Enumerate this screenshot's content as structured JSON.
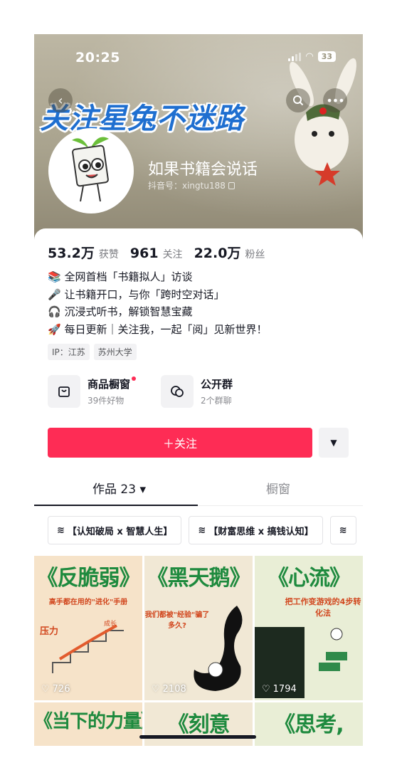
{
  "status_bar": {
    "time": "20:25",
    "battery": "33"
  },
  "banner": {
    "slogan": "关注星兔不迷路"
  },
  "profile": {
    "nickname": "如果书籍会说话",
    "douyin_id": "抖音号：xingtu188"
  },
  "stats": [
    {
      "value": "53.2万",
      "label": "获赞"
    },
    {
      "value": "961",
      "label": "关注"
    },
    {
      "value": "22.0万",
      "label": "粉丝"
    }
  ],
  "bio": [
    {
      "icon": "📚",
      "text": "全网首档「书籍拟人」访谈"
    },
    {
      "icon": "🎤",
      "text": "让书籍开口，与你「跨时空对话」"
    },
    {
      "icon": "🎧",
      "text": "沉浸式听书，解锁智慧宝藏"
    },
    {
      "icon": "🚀",
      "text": "每日更新｜关注我，一起「阅」见新世界！"
    }
  ],
  "tags": [
    "IP：江苏",
    "苏州大学"
  ],
  "features": {
    "shop": {
      "title": "商品橱窗",
      "sub": "39件好物"
    },
    "group": {
      "title": "公开群",
      "sub": "2个群聊"
    }
  },
  "follow_label": "＋关注",
  "tabs": {
    "works": "作品 23 ▾",
    "window": "橱窗"
  },
  "collections": [
    "【认知破局 x 智慧人生】",
    "【财富思维 x 搞钱认知】"
  ],
  "videos": [
    {
      "title": "《反脆弱》",
      "subtitle": "高手都在用的\"进化\"手册",
      "likes": "726"
    },
    {
      "title": "《黑天鹅》",
      "subtitle": "我们都被\"经验\"骗了多久?",
      "likes": "2108"
    },
    {
      "title": "《心流》",
      "subtitle": "把工作变游戏的4步转化法",
      "likes": "1794"
    },
    {
      "title": "《当下的力量》",
      "subtitle": "",
      "likes": ""
    },
    {
      "title": "《刻意",
      "subtitle": "",
      "likes": ""
    },
    {
      "title": "《思考,",
      "subtitle": "",
      "likes": ""
    }
  ],
  "colors": {
    "accent": "#fe2c55",
    "title_green": "#1e8a3e",
    "slogan_blue": "#1f6fd0"
  }
}
